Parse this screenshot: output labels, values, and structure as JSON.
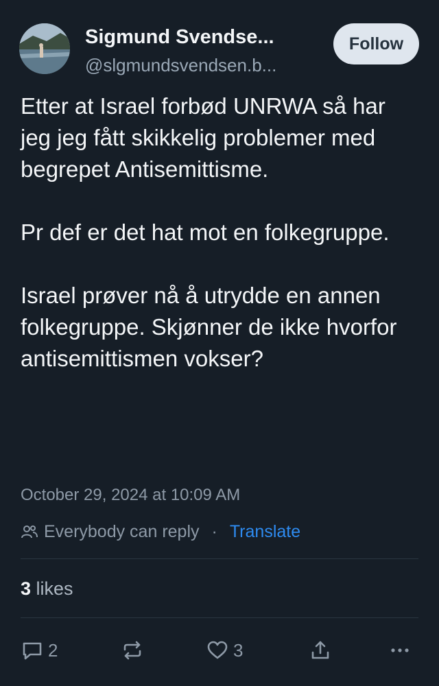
{
  "author": {
    "name": "Sigmund Svendse...",
    "handle": "@slgmundsvendsen.b..."
  },
  "follow_label": "Follow",
  "post": {
    "paragraphs": [
      "Etter at Israel forbød UNRWA så har jeg jeg fått skikkelig problemer med begrepet Antisemittisme.",
      "Pr def er det hat mot en folkegruppe.",
      "Israel prøver nå å utrydde en annen folkegruppe. Skjønner de ikke hvorfor antisemittismen vokser?"
    ],
    "timestamp": "October 29, 2024 at 10:09 AM"
  },
  "reply_setting": "Everybody can reply",
  "separator": "·",
  "translate_label": "Translate",
  "likes": {
    "count": "3",
    "label": "likes"
  },
  "actions": {
    "reply_count": "2",
    "like_count": "3"
  },
  "colors": {
    "background": "#161e27",
    "accent": "#2e8bf0"
  },
  "icons": [
    "people-icon",
    "reply-icon",
    "repost-icon",
    "heart-icon",
    "share-icon",
    "more-icon"
  ]
}
